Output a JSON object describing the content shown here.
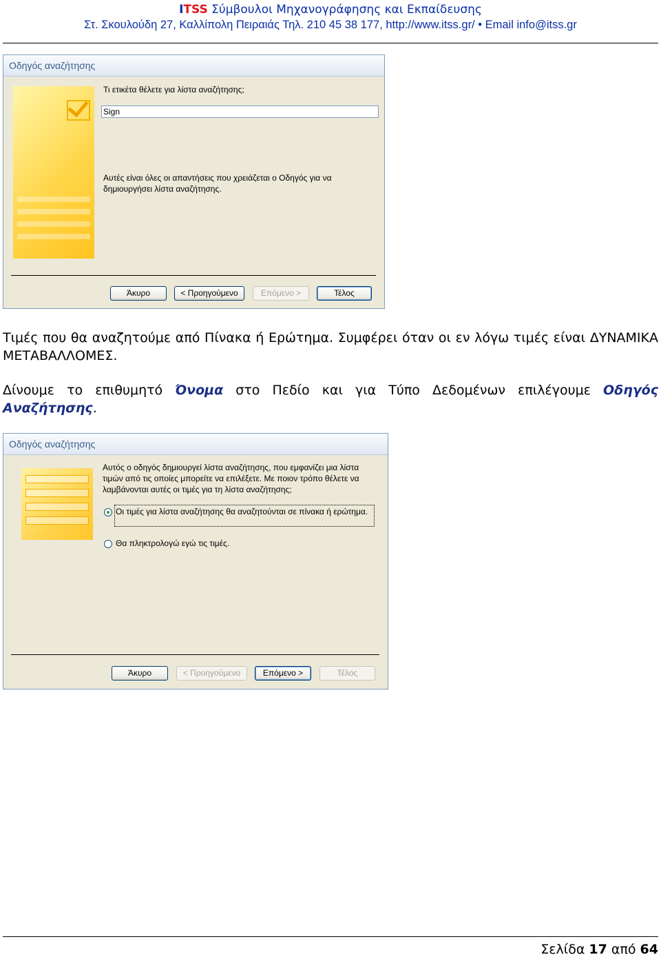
{
  "header": {
    "brand_i": "I",
    "brand_tss": "TSS",
    "title_rest": " Σύμβουλοι Μηχανογράφησης και Εκπαίδευσης",
    "address": "Στ. Σκουλούδη 27, Καλλίπολη Πειραιάς Τηλ. 210 45 38 177, ",
    "url": "http://www.itss.gr/",
    "bullet": "•",
    "email": "Email info@itss.gr"
  },
  "dialog1": {
    "title": "Οδηγός αναζήτησης",
    "question": "Τι ετικέτα θέλετε για λίστα αναζήτησης;",
    "label_value": "Sign",
    "info": "Αυτές είναι όλες οι απαντήσεις που χρειάζεται ο Οδηγός για να δημιουργήσει λίστα αναζήτησης.",
    "buttons": {
      "cancel": "Άκυρο",
      "back": "< Προηγούμενο",
      "next": "Επόμενο >",
      "finish": "Τέλος"
    }
  },
  "body": {
    "para1": "Τιμές που θα αναζητούμε από Πίνακα ή Ερώτημα. Συμφέρει όταν οι εν λόγω τιμές είναι ΔΥΝΑΜΙΚΑ ΜΕΤΑΒΑΛΛΟΜΕΣ.",
    "para2_a": "Δίνουμε το επιθυμητό ",
    "para2_name": "Όνομα",
    "para2_b": " στο Πεδίο και για Τύπο Δεδομένων επιλέγουμε ",
    "para2_wizard": "Οδηγός Αναζήτησης",
    "para2_end": "."
  },
  "dialog2": {
    "title": "Οδηγός αναζήτησης",
    "intro": "Αυτός ο οδηγός δημιουργεί λίστα αναζήτησης, που εμφανίζει μια λίστα τιμών από τις οποίες μπορείτε να επιλέξετε. Με ποιον τρόπο θέλετε να λαμβάνονται αυτές οι τιμές για τη λίστα αναζήτησης;",
    "option1": "Οι τιμές για λίστα αναζήτησης θα αναζητούνται σε πίνακα ή ερώτημα.",
    "option2": "Θα πληκτρολογώ εγώ τις τιμές.",
    "buttons": {
      "cancel": "Άκυρο",
      "back": "< Προηγούμενο",
      "next": "Επόμενο >",
      "finish": "Τέλος"
    }
  },
  "footer": {
    "page_word": "Σελίδα ",
    "page_num": "17",
    "of_word": " από ",
    "total": "64"
  }
}
